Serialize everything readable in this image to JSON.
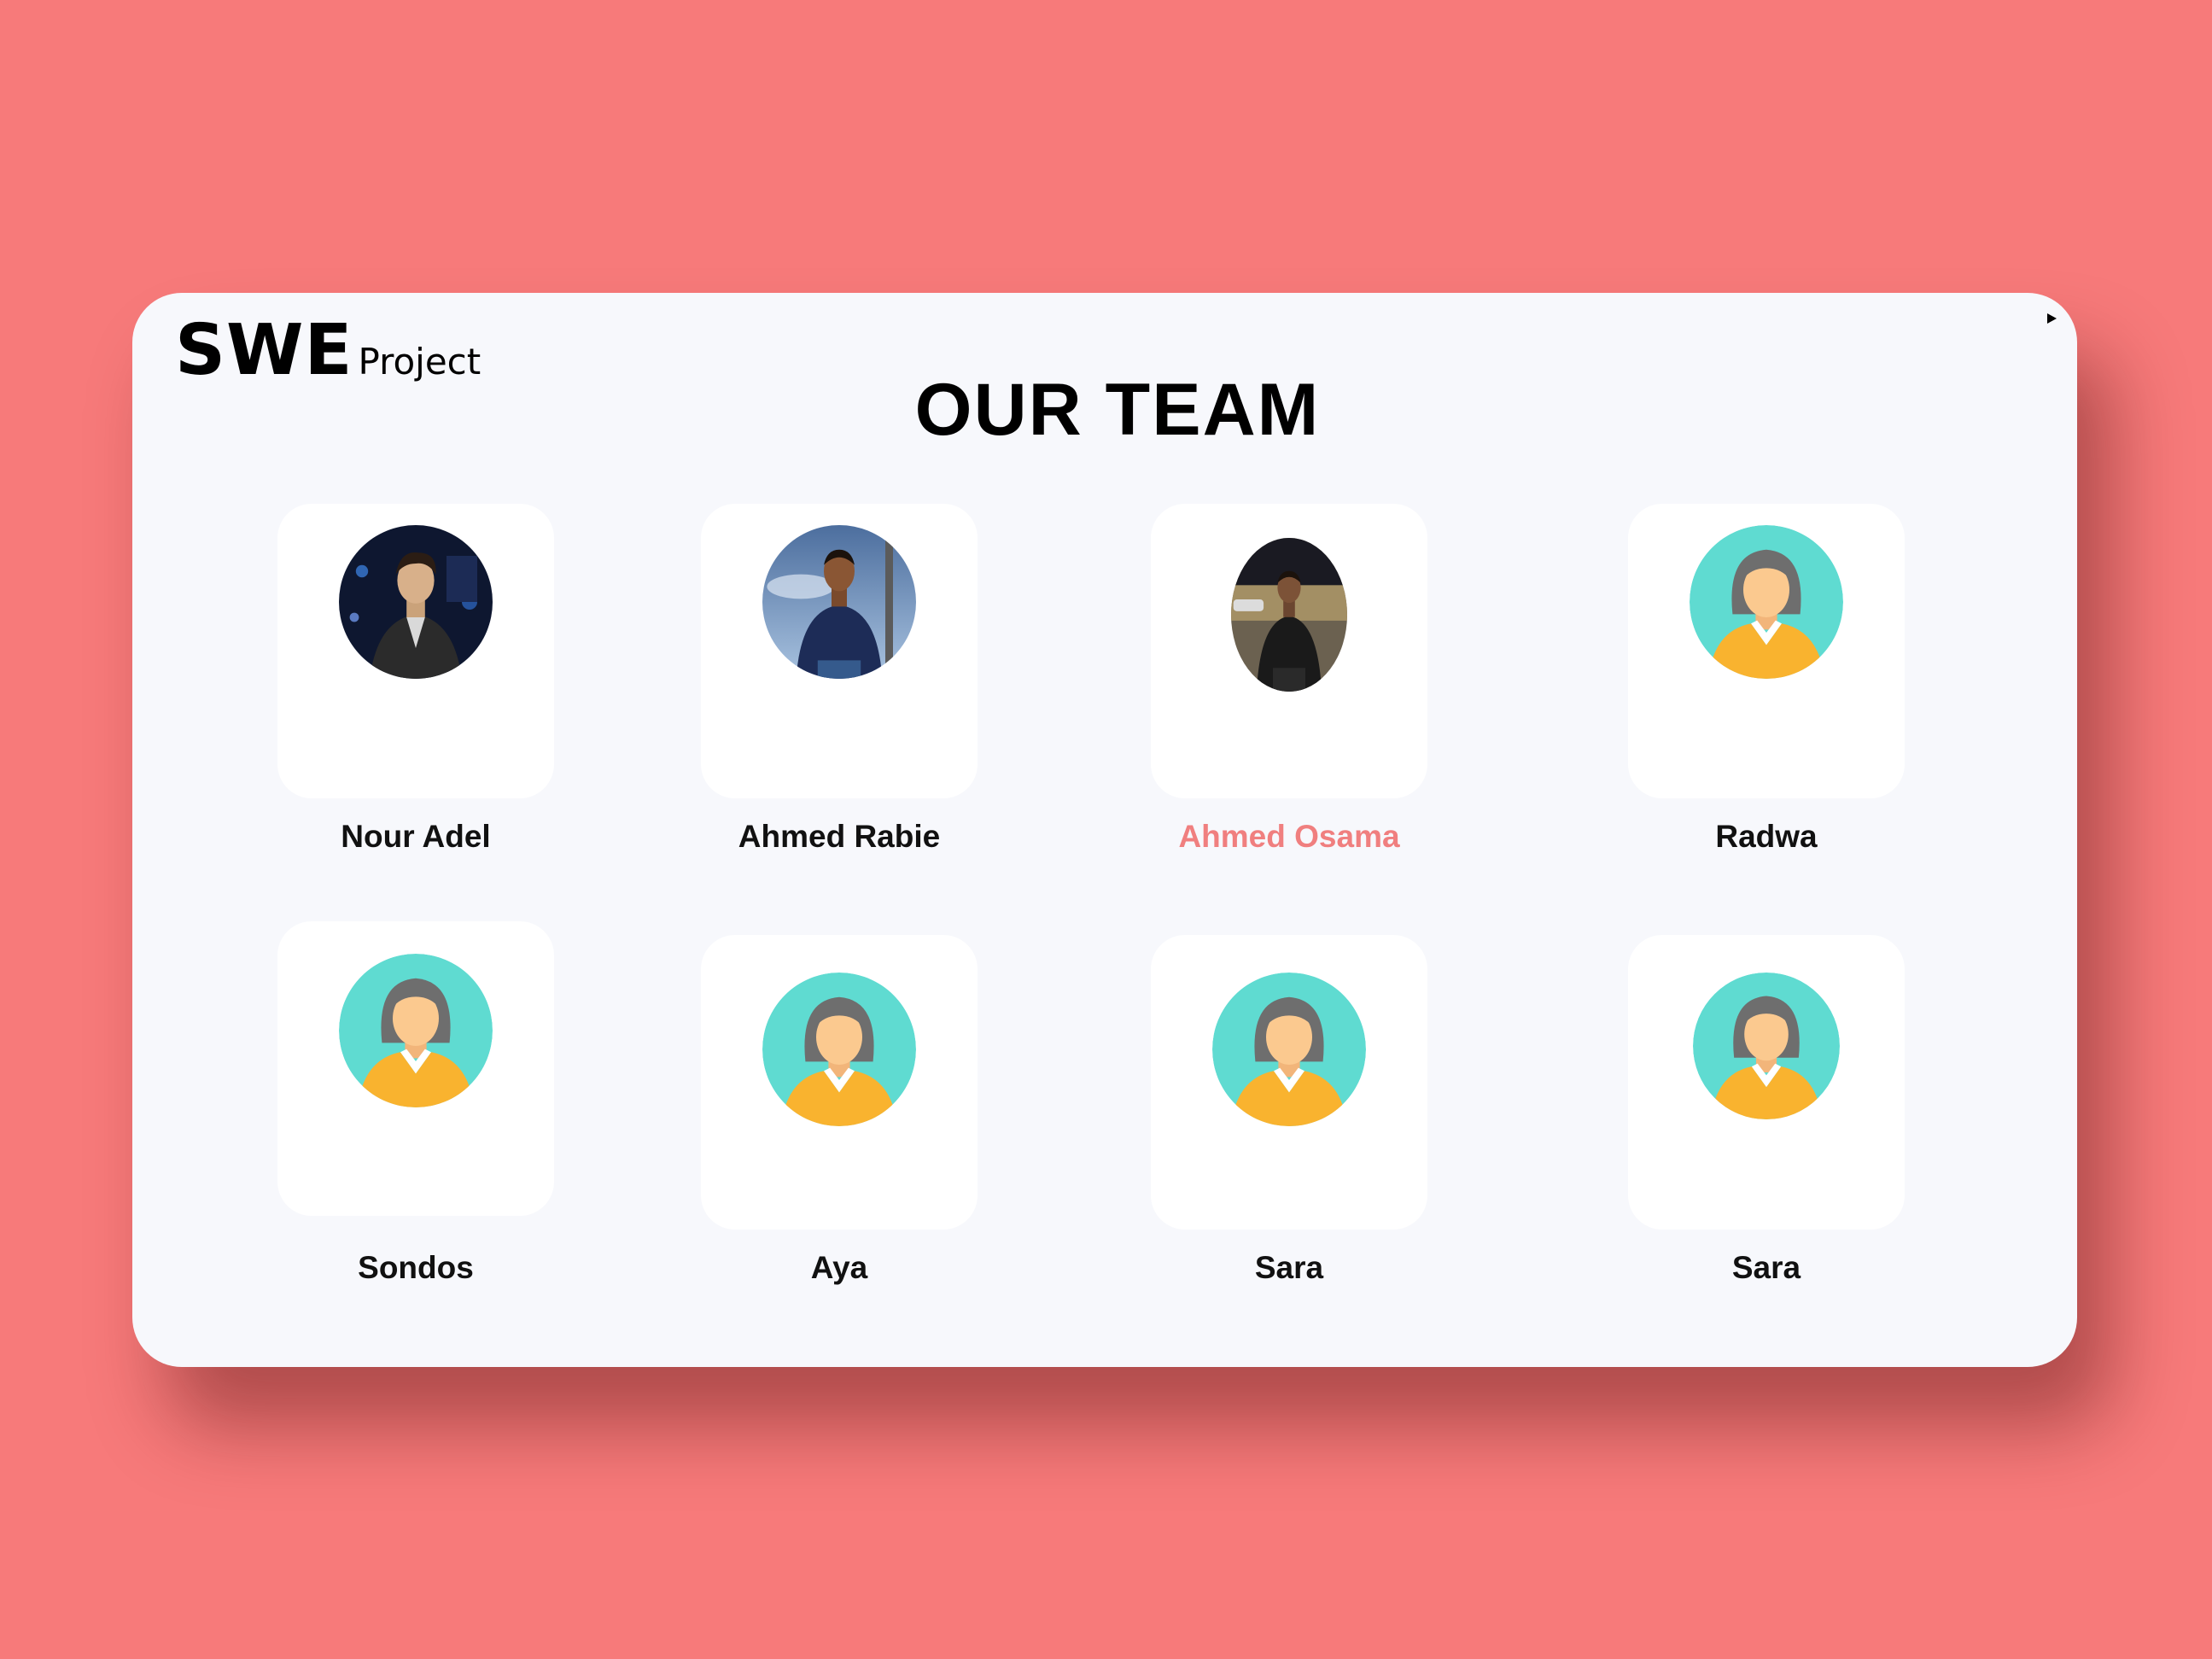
{
  "brand": {
    "main": "SWE",
    "sub": "Project"
  },
  "page_title": "OUR TEAM",
  "team": [
    {
      "name": "Nour Adel",
      "avatar": "photo-man-leather-jacket-night"
    },
    {
      "name": "Ahmed Rabie",
      "avatar": "photo-man-blue-sweater-sky"
    },
    {
      "name": "Ahmed Osama",
      "avatar": "photo-man-black-tshirt-street",
      "highlighted": true
    },
    {
      "name": "Radwa",
      "avatar": "female-avatar-icon"
    },
    {
      "name": "Sondos",
      "avatar": "female-avatar-icon"
    },
    {
      "name": "Aya",
      "avatar": "female-avatar-icon"
    },
    {
      "name": "Sara",
      "avatar": "female-avatar-icon"
    },
    {
      "name": "Sara",
      "avatar": "female-avatar-icon"
    }
  ],
  "colors": {
    "background": "#f77a7a",
    "window": "#f7f8fc",
    "card": "#ffffff",
    "highlight_text": "#f07f7f",
    "avatar_teal": "#5fdbd1",
    "avatar_hair": "#6e6e6e",
    "avatar_skin": "#fbc98f",
    "avatar_shirt": "#f9b32f"
  }
}
